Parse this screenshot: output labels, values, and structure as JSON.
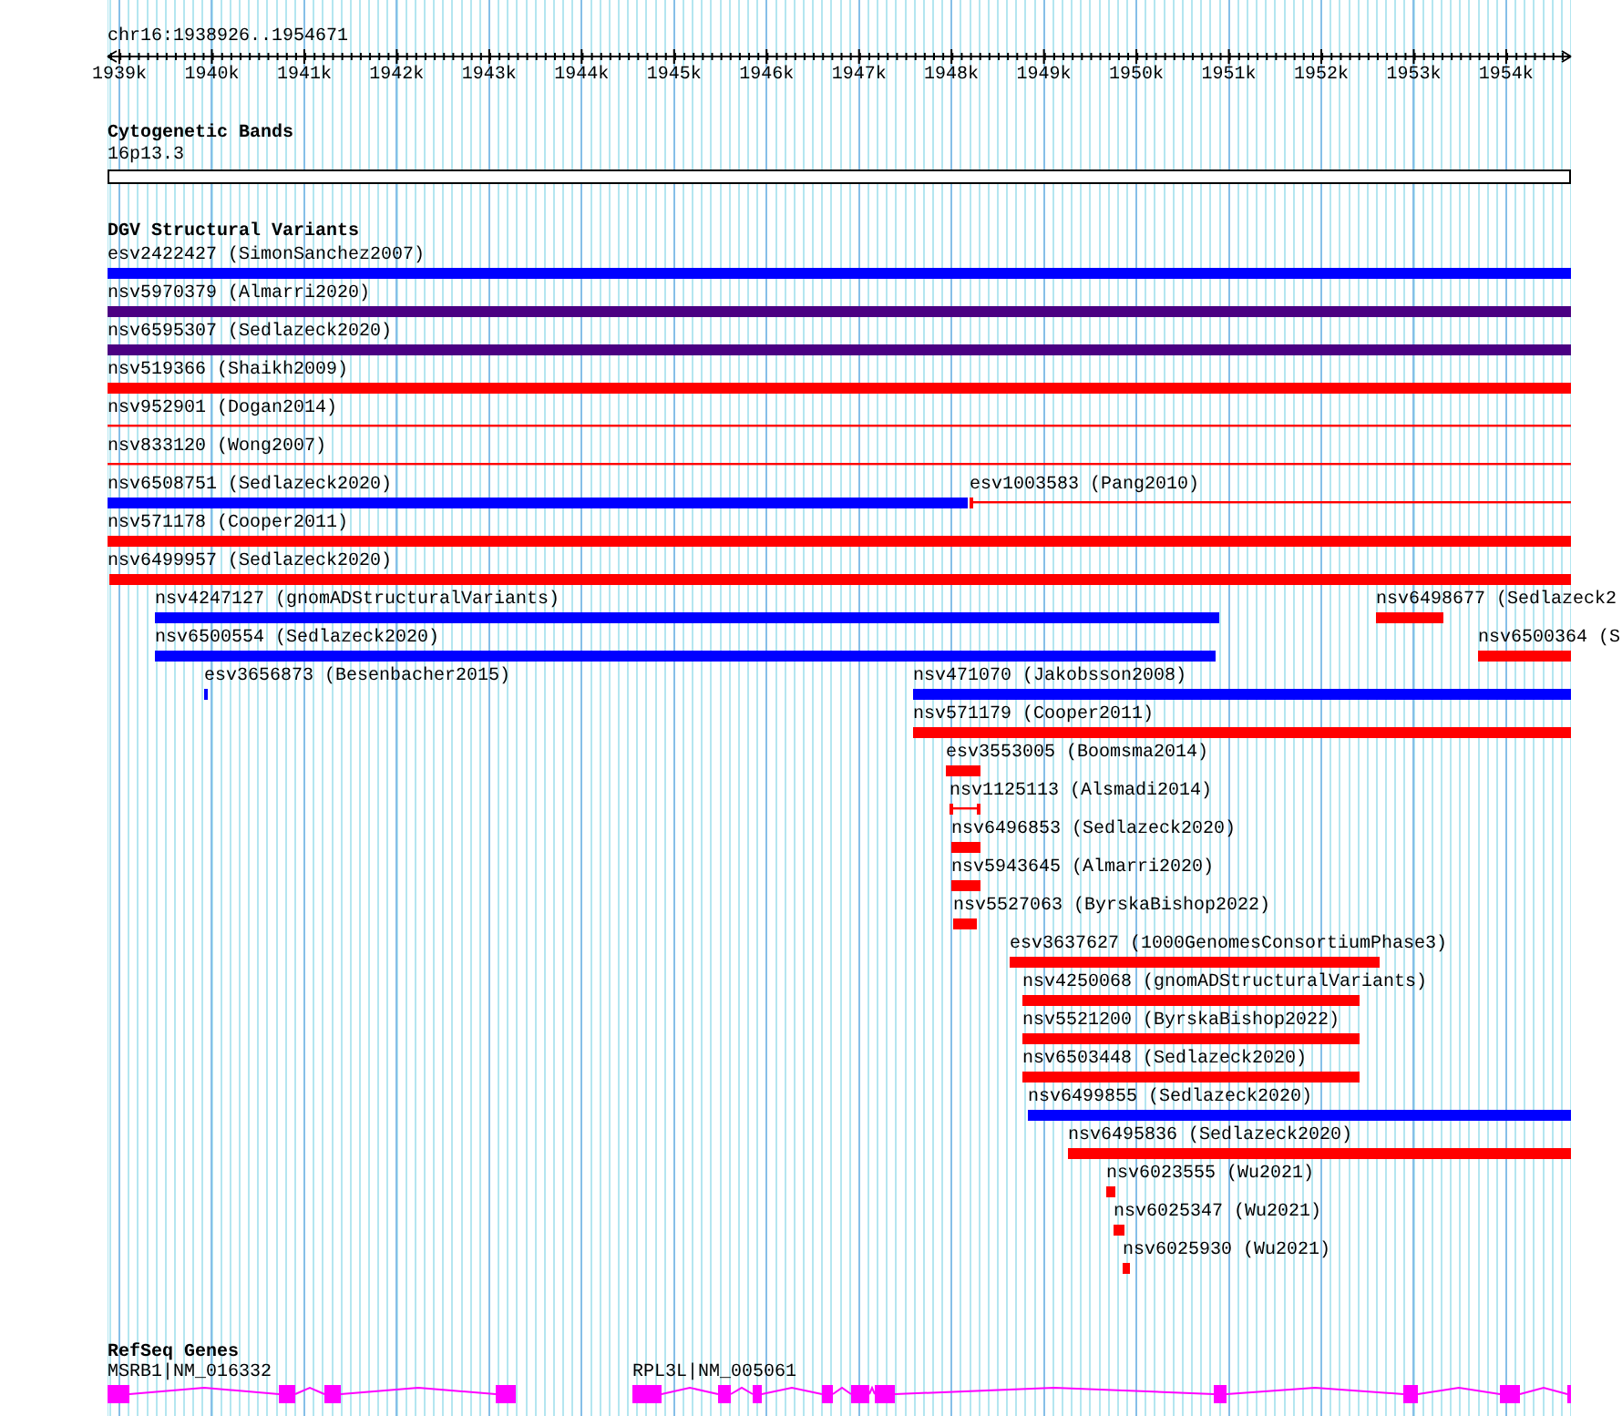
{
  "ruler": {
    "location": "chr16:1938926..1954671",
    "ticks": [
      "1939k",
      "1940k",
      "1941k",
      "1942k",
      "1943k",
      "1944k",
      "1945k",
      "1946k",
      "1947k",
      "1948k",
      "1949k",
      "1950k",
      "1951k",
      "1952k",
      "1953k",
      "1954k"
    ]
  },
  "cytogenetic_bands": {
    "title": "Cytogenetic Bands",
    "band": "16p13.3"
  },
  "dgv": {
    "title": "DGV Structural Variants",
    "features": [
      {
        "label": "esv2422427 (SimonSanchez2007)",
        "color": "#0000ff",
        "kind": "thick"
      },
      {
        "label": "nsv5970379 (Almarri2020)",
        "color": "#4b0082",
        "kind": "thick"
      },
      {
        "label": "nsv6595307 (Sedlazeck2020)",
        "color": "#4b0082",
        "kind": "thick"
      },
      {
        "label": "nsv519366 (Shaikh2009)",
        "color": "#ff0000",
        "kind": "thick"
      },
      {
        "label": "nsv952901 (Dogan2014)",
        "color": "#ff0000",
        "kind": "thin"
      },
      {
        "label": "nsv833120 (Wong2007)",
        "color": "#ff0000",
        "kind": "thin"
      },
      {
        "label": "nsv6508751 (Sedlazeck2020)",
        "color": "#0000ff",
        "kind": "thick"
      },
      {
        "label": "esv1003583 (Pang2010)",
        "color": "#ff0000",
        "kind": "thin-whiskers"
      },
      {
        "label": "nsv571178 (Cooper2011)",
        "color": "#ff0000",
        "kind": "thick"
      },
      {
        "label": "nsv6499957 (Sedlazeck2020)",
        "color": "#ff0000",
        "kind": "thick"
      },
      {
        "label": "nsv4247127 (gnomADStructuralVariants)",
        "color": "#0000ff",
        "kind": "thick"
      },
      {
        "label": "nsv6498677 (Sedlazeck2",
        "color": "#ff0000",
        "kind": "thick"
      },
      {
        "label": "nsv6500554 (Sedlazeck2020)",
        "color": "#0000ff",
        "kind": "thick"
      },
      {
        "label": "nsv6500364 (S",
        "color": "#ff0000",
        "kind": "thick"
      },
      {
        "label": "esv3656873 (Besenbacher2015)",
        "color": "#0000ff",
        "kind": "thick"
      },
      {
        "label": "nsv471070 (Jakobsson2008)",
        "color": "#0000ff",
        "kind": "thick"
      },
      {
        "label": "nsv571179 (Cooper2011)",
        "color": "#ff0000",
        "kind": "thick"
      },
      {
        "label": "esv3553005 (Boomsma2014)",
        "color": "#ff0000",
        "kind": "thick-whiskers"
      },
      {
        "label": "nsv1125113 (Alsmadi2014)",
        "color": "#ff0000",
        "kind": "thin-whiskers"
      },
      {
        "label": "nsv6496853 (Sedlazeck2020)",
        "color": "#ff0000",
        "kind": "thick"
      },
      {
        "label": "nsv5943645 (Almarri2020)",
        "color": "#ff0000",
        "kind": "thick"
      },
      {
        "label": "nsv5527063 (ByrskaBishop2022)",
        "color": "#ff0000",
        "kind": "thick"
      },
      {
        "label": "esv3637627 (1000GenomesConsortiumPhase3)",
        "color": "#ff0000",
        "kind": "thick-whiskers"
      },
      {
        "label": "nsv4250068 (gnomADStructuralVariants)",
        "color": "#ff0000",
        "kind": "thick"
      },
      {
        "label": "nsv5521200 (ByrskaBishop2022)",
        "color": "#ff0000",
        "kind": "thick"
      },
      {
        "label": "nsv6503448 (Sedlazeck2020)",
        "color": "#ff0000",
        "kind": "thick"
      },
      {
        "label": "nsv6499855 (Sedlazeck2020)",
        "color": "#0000ff",
        "kind": "thick"
      },
      {
        "label": "nsv6495836 (Sedlazeck2020)",
        "color": "#ff0000",
        "kind": "thick"
      },
      {
        "label": "nsv6023555 (Wu2021)",
        "color": "#ff0000",
        "kind": "thick"
      },
      {
        "label": "nsv6025347 (Wu2021)",
        "color": "#ff0000",
        "kind": "thick"
      },
      {
        "label": "nsv6025930 (Wu2021)",
        "color": "#ff0000",
        "kind": "thick"
      }
    ]
  },
  "refseq_genes": {
    "title": "RefSeq Genes",
    "genes": [
      {
        "label": "MSRB1|NM_016332"
      },
      {
        "label": "RPL3L|NM_005061"
      }
    ]
  }
}
